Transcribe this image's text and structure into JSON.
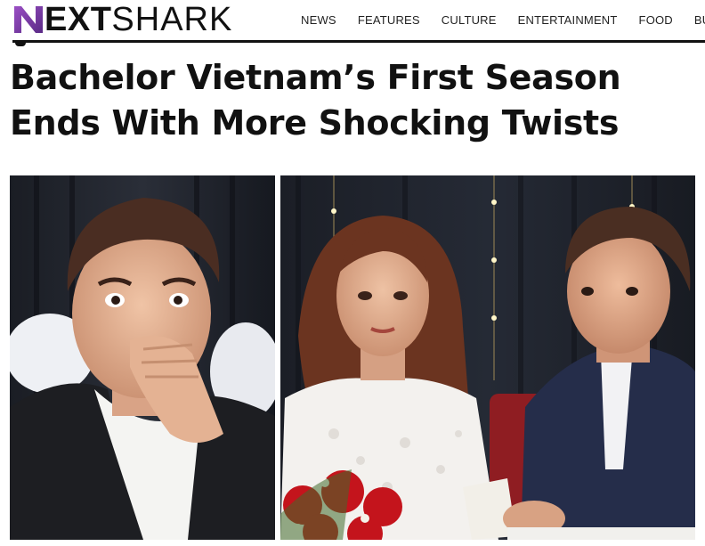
{
  "site": {
    "logo_bold": "NEXT",
    "logo_light": "SHARK",
    "logo_mark": "N"
  },
  "nav": {
    "items": [
      {
        "label": "NEWS"
      },
      {
        "label": "FEATURES"
      },
      {
        "label": "CULTURE"
      },
      {
        "label": "ENTERTAINMENT"
      },
      {
        "label": "FOOD"
      },
      {
        "label": "BU"
      }
    ]
  },
  "article": {
    "headline": "Bachelor Vietnam’s First Season Ends With More Shocking Twists"
  },
  "images": {
    "left": {
      "icon": "shocked-man-photo"
    },
    "right": {
      "icon": "couple-photo"
    }
  },
  "colors": {
    "accent_purple": "#7b3fa0",
    "header_rule": "#111111",
    "text": "#111111"
  }
}
